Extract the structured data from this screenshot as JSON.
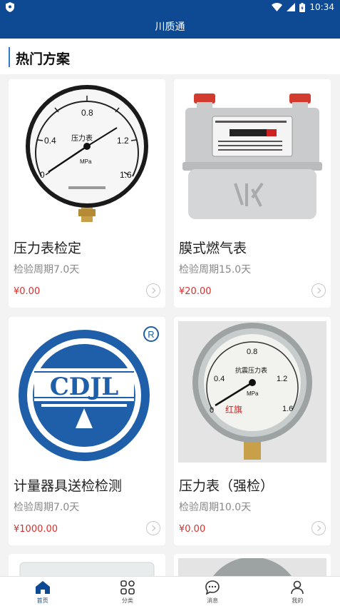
{
  "status_bar": {
    "time": "10:34"
  },
  "app": {
    "title": "川质通"
  },
  "section": {
    "title": "热门方案"
  },
  "products": [
    {
      "name": "压力表检定",
      "period": "检验周期7.0天",
      "price": "¥0.00",
      "image": "pressure-gauge-image"
    },
    {
      "name": "膜式燃气表",
      "period": "检验周期15.0天",
      "price": "¥20.00",
      "image": "gas-meter-image"
    },
    {
      "name": "计量器具送检检测",
      "period": "检验周期7.0天",
      "price": "¥1000.00",
      "image": "cdjl-logo-image",
      "logo_text": "CDJL"
    },
    {
      "name": "压力表（强检）",
      "period": "检验周期10.0天",
      "price": "¥0.00",
      "image": "pressure-gauge-image"
    }
  ],
  "tabs": [
    {
      "label": "首页",
      "icon": "home-icon",
      "active": true
    },
    {
      "label": "分类",
      "icon": "category-icon",
      "active": false
    },
    {
      "label": "消息",
      "icon": "message-icon",
      "active": false
    },
    {
      "label": "我的",
      "icon": "user-icon",
      "active": false
    }
  ],
  "colors": {
    "primary": "#0d4a93",
    "price": "#d9302c",
    "accent": "#2d7ad6"
  }
}
